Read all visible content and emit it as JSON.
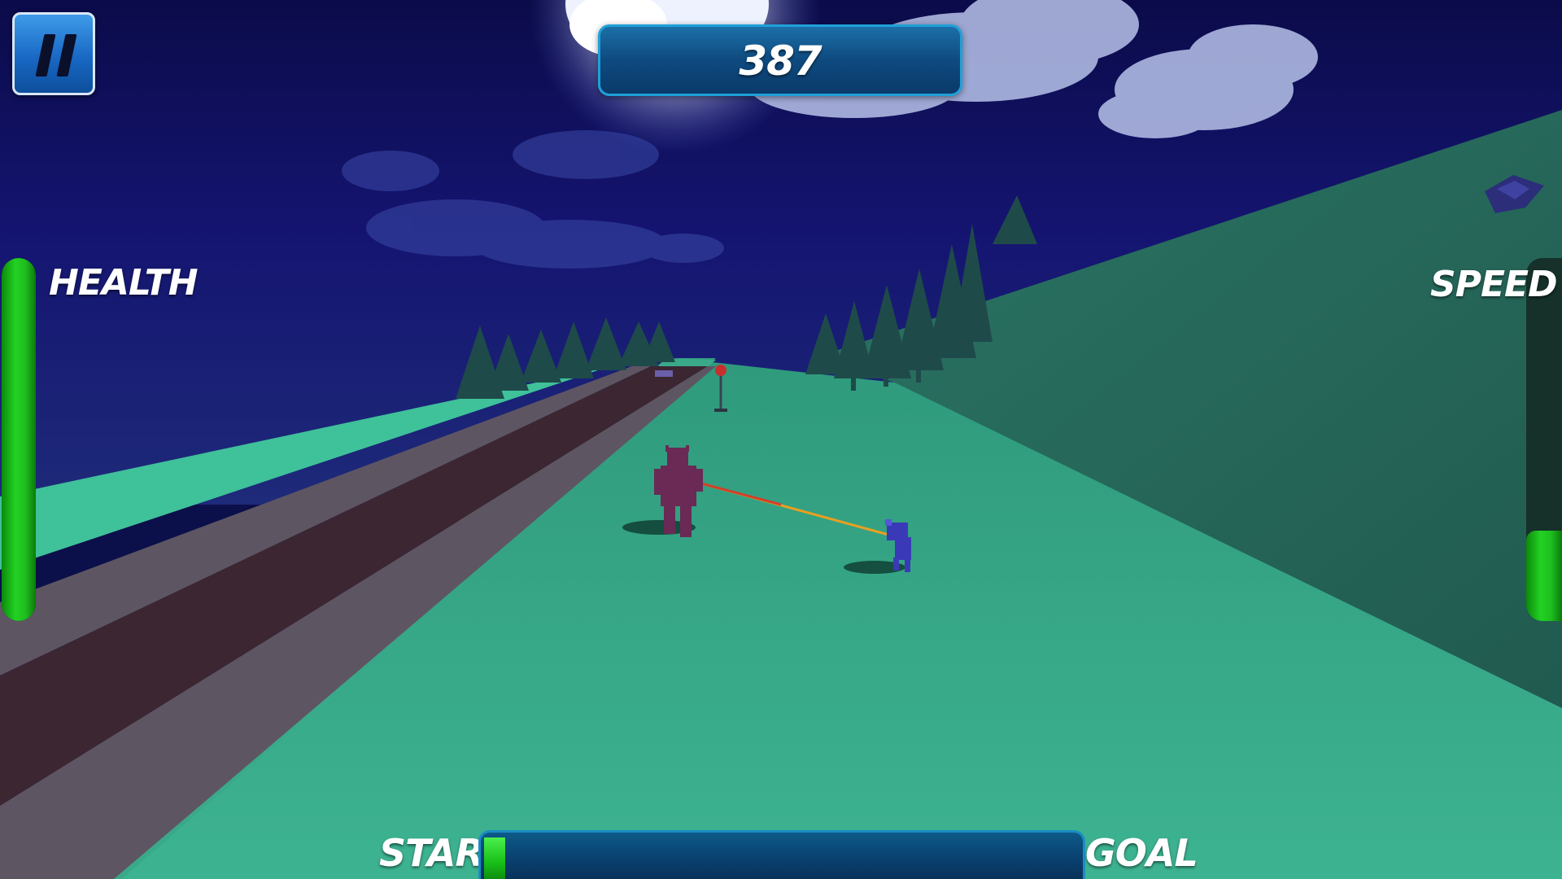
{
  "hud": {
    "score": "387",
    "health_label": "HEALTH",
    "speed_label": "SPEED",
    "start_label": "START",
    "goal_label": "GOAL",
    "pause_icon": "pause-icon",
    "health_level": 1.0,
    "speed_level": 0.25,
    "progress_level": 0.035
  },
  "colors": {
    "sky": "#12125e",
    "ground": "#3aa588",
    "road": "#3b2632",
    "road_edge": "#5e5563",
    "hud_blue": "#0e4a7f",
    "bar_green": "#1fbd1f"
  }
}
